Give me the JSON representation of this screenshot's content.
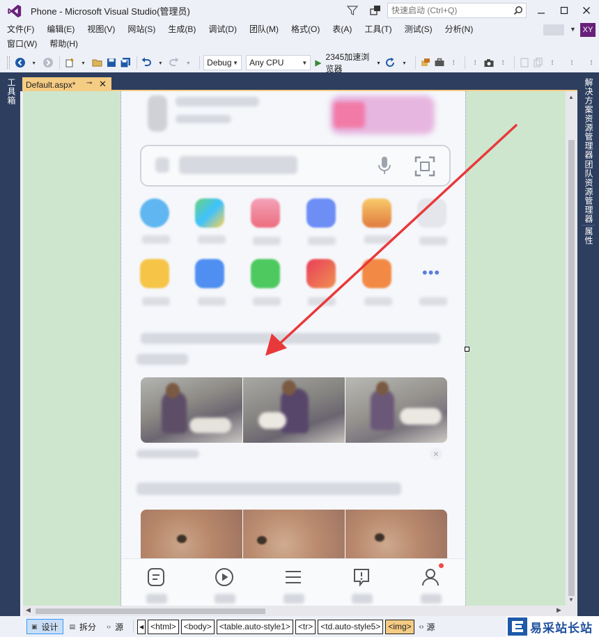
{
  "window": {
    "title": "Phone - Microsoft Visual Studio(管理员)",
    "quick_launch_placeholder": "快速启动 (Ctrl+Q)",
    "user_initials": "XY"
  },
  "menu": {
    "row1": [
      "文件(F)",
      "编辑(E)",
      "视图(V)",
      "网站(S)",
      "生成(B)",
      "调试(D)",
      "团队(M)",
      "格式(O)",
      "表(A)",
      "工具(T)",
      "测试(S)",
      "分析(N)"
    ],
    "row2": [
      "窗口(W)",
      "帮助(H)"
    ]
  },
  "toolbar": {
    "config": "Debug",
    "platform": "Any CPU",
    "run_target": "2345加速浏览器"
  },
  "side_panels": {
    "left": "工具箱",
    "right": [
      "解决方案资源管理器",
      "团队资源管理器",
      "属性"
    ]
  },
  "document_tab": {
    "name": "Default.aspx*"
  },
  "bottom": {
    "views": [
      "设计",
      "拆分",
      "源"
    ],
    "breadcrumbs": [
      "<html>",
      "<body>",
      "<table.auto-style1>",
      "<tr>",
      "<td.auto-style5>",
      "<img>"
    ],
    "trailing": "源"
  },
  "watermark": {
    "text": "易采站长站"
  },
  "colors": {
    "vs_purple": "#68217a",
    "tab_gold": "#f5cc84",
    "panel_navy": "#2d3e5f",
    "design_green": "#cfe6ce",
    "arrow_red": "#e8393a"
  }
}
